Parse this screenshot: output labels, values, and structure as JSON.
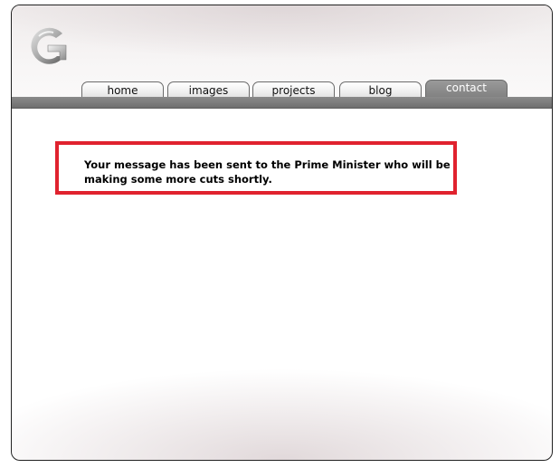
{
  "nav": {
    "tabs": [
      {
        "label": "home",
        "active": false
      },
      {
        "label": "images",
        "active": false
      },
      {
        "label": "projects",
        "active": false
      },
      {
        "label": "blog",
        "active": false
      },
      {
        "label": "contact",
        "active": true
      }
    ]
  },
  "message": {
    "text": "Your message has been sent to the Prime Minister who will be making some more cuts shortly."
  },
  "colors": {
    "message_border": "#e0222e",
    "nav_bar": "#7a7a7a",
    "active_tab": "#8c8c8c"
  },
  "logo": {
    "icon": "site-logo-g-icon"
  }
}
